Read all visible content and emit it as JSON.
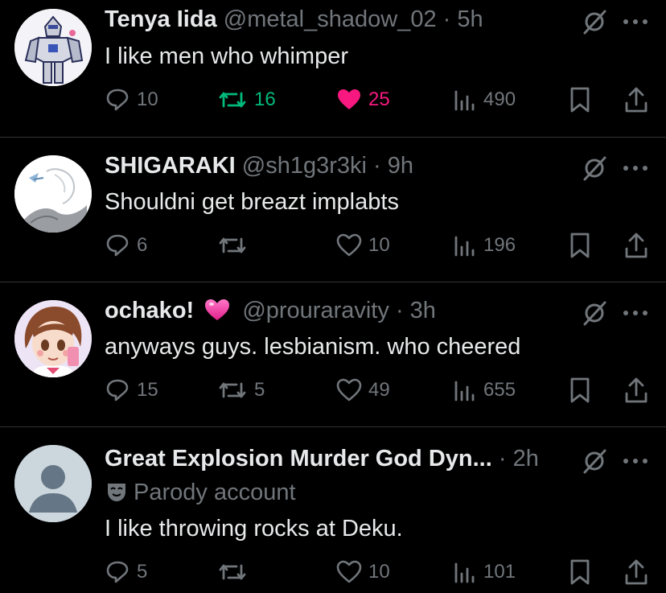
{
  "colors": {
    "background": "#000000",
    "text": "#e7e9ea",
    "muted": "#71767b",
    "retweet_active": "#00ba7c",
    "like_active": "#f91880"
  },
  "tweets": [
    {
      "name": "Tenya Iida",
      "handle": "@metal_shadow_02",
      "dot": "·",
      "time": "5h",
      "text": "I like men who whimper",
      "replies": "10",
      "retweets": "16",
      "likes": "25",
      "views": "490",
      "retweeted": true,
      "liked": true,
      "avatar": "robot-armor-avatar"
    },
    {
      "name": "SHIGARAKI",
      "handle": "@sh1g3r3ki",
      "dot": "·",
      "time": "9h",
      "text": "Shouldni get breazt implabts",
      "replies": "6",
      "retweets": "",
      "likes": "10",
      "views": "196",
      "retweeted": false,
      "liked": false,
      "avatar": "sketch-avatar"
    },
    {
      "name": "ochako!",
      "name_emoji": "pink-heart-emoji",
      "handle": "@prouraravity",
      "dot": "·",
      "time": "3h",
      "text": "anyways guys. lesbianism. who cheered",
      "replies": "15",
      "retweets": "5",
      "likes": "49",
      "views": "655",
      "retweeted": false,
      "liked": false,
      "avatar": "anime-girl-avatar"
    },
    {
      "name": "Great Explosion Murder God Dyn...",
      "handle": "",
      "dot": "·",
      "time": "2h",
      "parody_label": "Parody account",
      "text": "I like throwing rocks at Deku.",
      "replies": "5",
      "retweets": "",
      "likes": "10",
      "views": "101",
      "retweeted": false,
      "liked": false,
      "avatar": "default-person-avatar"
    }
  ]
}
